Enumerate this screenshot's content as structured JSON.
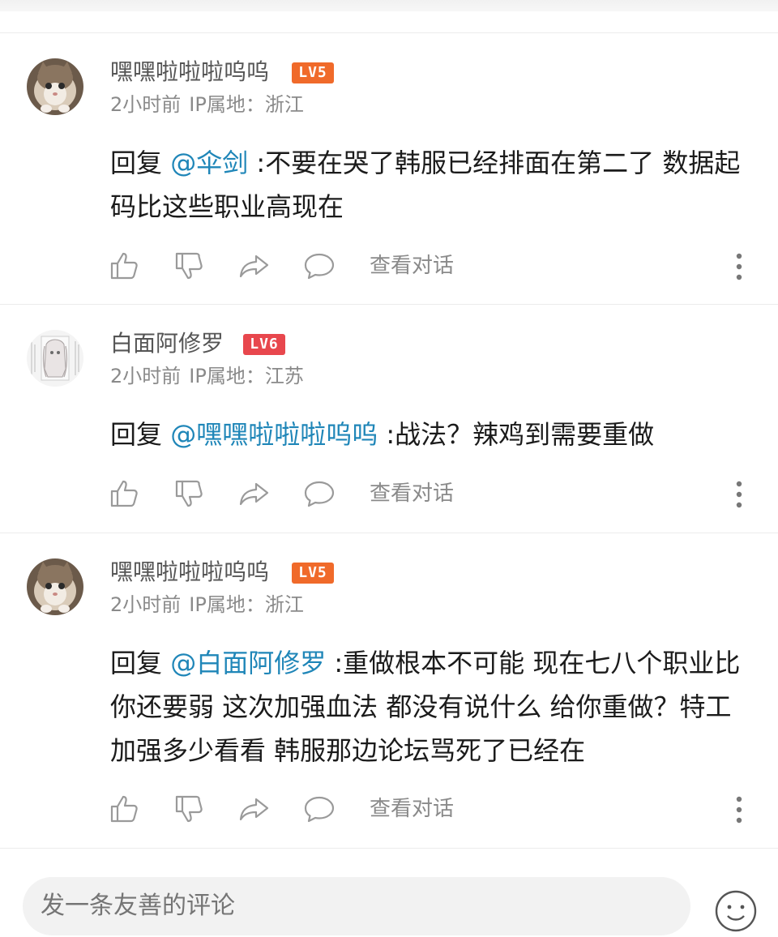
{
  "theme": {
    "mention_color": "#1f86b8",
    "lv5_color": "#f06a2a",
    "lv6_color": "#e8474d",
    "icon_color": "#9a9a9a"
  },
  "comments": [
    {
      "username": "嘿嘿啦啦啦呜呜",
      "level": "LV5",
      "time": "2小时前",
      "ip": "IP属地：浙江",
      "reply_prefix": "回复 ",
      "mention": "@伞剑",
      "text": " :不要在哭了韩服已经排面在第二了  数据起码比这些职业高现在",
      "view_conversation": "查看对话",
      "avatar_icon": "cat-avatar"
    },
    {
      "username": "白面阿修罗",
      "level": "LV6",
      "time": "2小时前",
      "ip": "IP属地：江苏",
      "reply_prefix": "回复 ",
      "mention": "@嘿嘿啦啦啦呜呜",
      "text": " :战法？辣鸡到需要重做",
      "view_conversation": "查看对话",
      "avatar_icon": "anime-girl-avatar"
    },
    {
      "username": "嘿嘿啦啦啦呜呜",
      "level": "LV5",
      "time": "2小时前",
      "ip": "IP属地：浙江",
      "reply_prefix": "回复 ",
      "mention": "@白面阿修罗",
      "text": " :重做根本不可能  现在七八个职业比你还要弱 这次加强血法  都没有说什么   给你重做？特工 加强多少看看  韩服那边论坛骂死了已经在",
      "view_conversation": "查看对话",
      "avatar_icon": "cat-avatar"
    }
  ],
  "input": {
    "placeholder": "发一条友善的评论"
  }
}
